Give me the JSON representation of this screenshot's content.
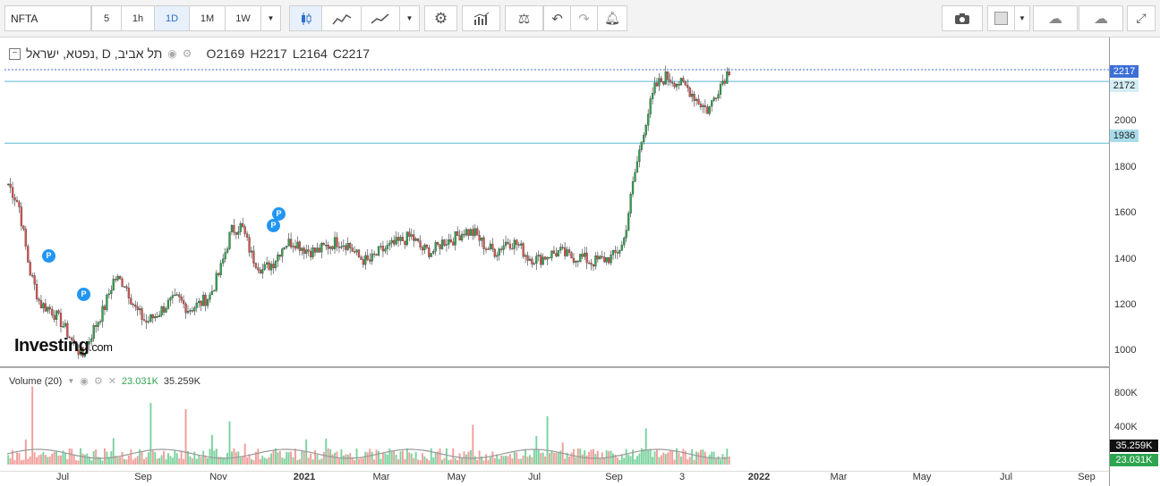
{
  "toolbar": {
    "symbol": "NFTA",
    "intervals": [
      "5",
      "1h",
      "1D",
      "1M",
      "1W"
    ],
    "active_interval": "1D"
  },
  "legend": {
    "title": "תל אביב, D ,נפטא, ישראל",
    "open": "O2169",
    "high": "H2217",
    "low": "L2164",
    "close": "C2217"
  },
  "volume": {
    "label": "Volume (20)",
    "value": "23.031K",
    "avg": "35.259K"
  },
  "price_axis": [
    "2000",
    "1800",
    "1600",
    "1400",
    "1200",
    "1000"
  ],
  "volume_axis": [
    "800K",
    "400K"
  ],
  "price_tags": {
    "last": "2217",
    "line1": "2172",
    "line2": "1936",
    "vol_avg": "35.259K",
    "vol_last": "23.031K"
  },
  "time_axis": [
    {
      "label": "Jul",
      "bold": false
    },
    {
      "label": "Sep",
      "bold": false
    },
    {
      "label": "Nov",
      "bold": false
    },
    {
      "label": "2021",
      "bold": true
    },
    {
      "label": "Mar",
      "bold": false
    },
    {
      "label": "May",
      "bold": false
    },
    {
      "label": "Jul",
      "bold": false
    },
    {
      "label": "Sep",
      "bold": false
    },
    {
      "label": "3",
      "bold": false
    },
    {
      "label": "2022",
      "bold": true
    },
    {
      "label": "Mar",
      "bold": false
    },
    {
      "label": "May",
      "bold": false
    },
    {
      "label": "Jul",
      "bold": false
    },
    {
      "label": "Sep",
      "bold": false
    }
  ],
  "markers": [
    "P",
    "P",
    "P",
    "P"
  ],
  "logo": {
    "main": "Investing",
    "suffix": ".com"
  },
  "colors": {
    "up": "#2ea44f",
    "down": "#d9534f",
    "hline": "#5bb8d4",
    "last": "#3d6fd6",
    "vol_up": "#7dd3a0",
    "vol_down": "#f2a09c"
  },
  "chart_data": {
    "type": "candlestick",
    "ylim": [
      950,
      2300
    ],
    "series_close": [
      1780,
      1700,
      1450,
      1320,
      1300,
      1250,
      1180,
      1120,
      1220,
      1300,
      1420,
      1400,
      1300,
      1250,
      1280,
      1320,
      1340,
      1300,
      1320,
      1350,
      1450,
      1600,
      1620,
      1500,
      1450,
      1480,
      1550,
      1560,
      1530,
      1520,
      1540,
      1560,
      1550,
      1500,
      1480,
      1520,
      1540,
      1560,
      1580,
      1530,
      1520,
      1560,
      1570,
      1600,
      1590,
      1540,
      1520,
      1560,
      1550,
      1500,
      1490,
      1510,
      1520,
      1500,
      1500,
      1480,
      1490,
      1500,
      1550,
      1800,
      2000,
      2150,
      2190,
      2170,
      2150,
      2100,
      2060,
      2150,
      2217
    ]
  }
}
